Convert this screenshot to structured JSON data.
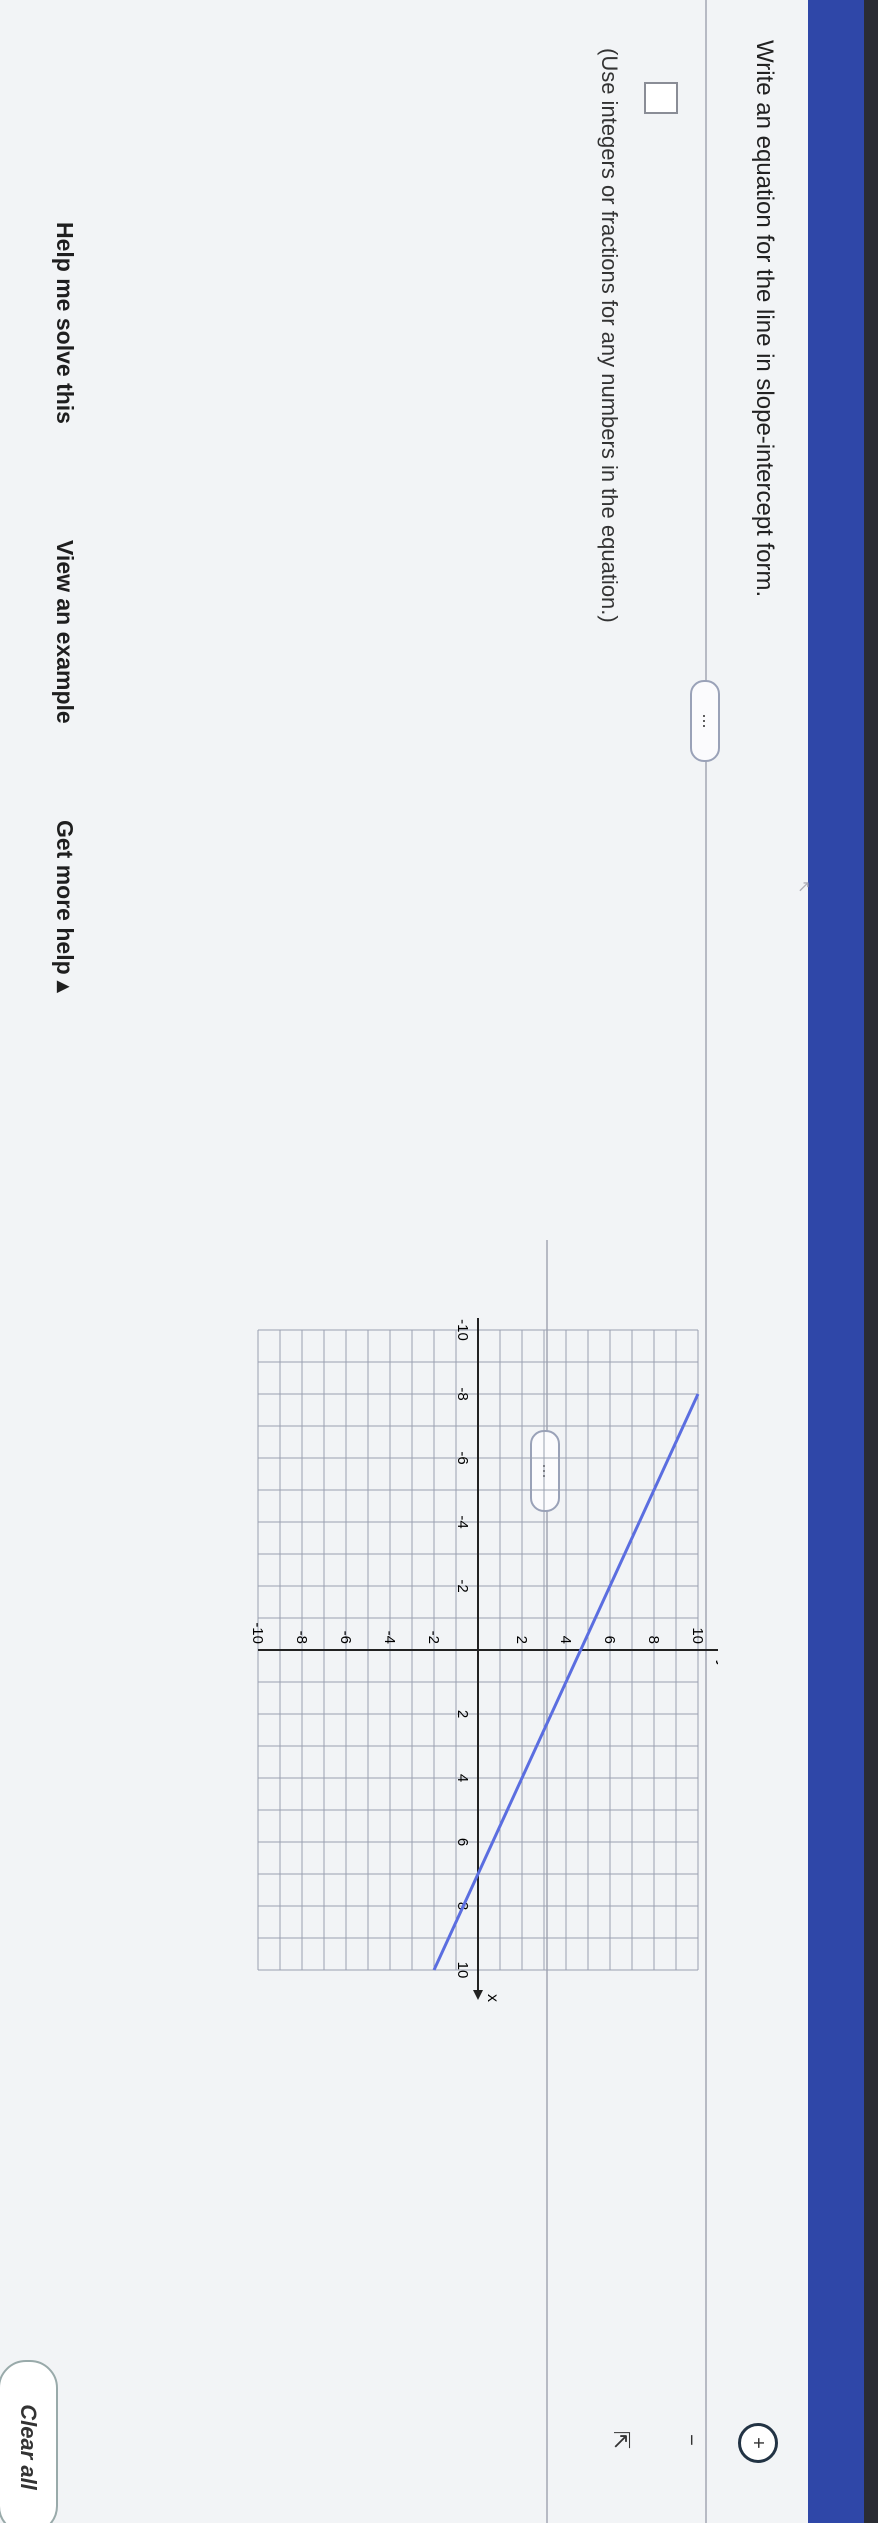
{
  "question": {
    "prompt": "Write an equation for the line in slope-intercept form.",
    "hint": "(Use integers or fractions for any numbers in the equation.)"
  },
  "dividers": {
    "more_label": "..."
  },
  "answer": {
    "value": ""
  },
  "help": {
    "solve": "Help me solve this",
    "example": "View an example",
    "more": "Get more help ▴"
  },
  "tools": {
    "zoom_in": "+",
    "zoom_out": "−",
    "pop_out": "⇱"
  },
  "clear_all": "Clear all",
  "graph": {
    "x_label": "x",
    "y_label": "y",
    "x_ticks": [
      "-10",
      "-8",
      "-6",
      "-4",
      "-2",
      "2",
      "4",
      "6",
      "8",
      "10"
    ],
    "y_ticks": [
      "10",
      "8",
      "6",
      "4",
      "2",
      "-2",
      "-4",
      "-6",
      "-8",
      "-10"
    ],
    "line_color": "#5b6ee0",
    "grid_color": "#9aa0b0"
  },
  "chart_data": {
    "type": "line",
    "title": "",
    "xlabel": "x",
    "ylabel": "y",
    "xlim": [
      -10,
      10
    ],
    "ylim": [
      -10,
      10
    ],
    "grid": true,
    "series": [
      {
        "x": [
          -8,
          10
        ],
        "y": [
          10,
          -2
        ]
      }
    ]
  }
}
